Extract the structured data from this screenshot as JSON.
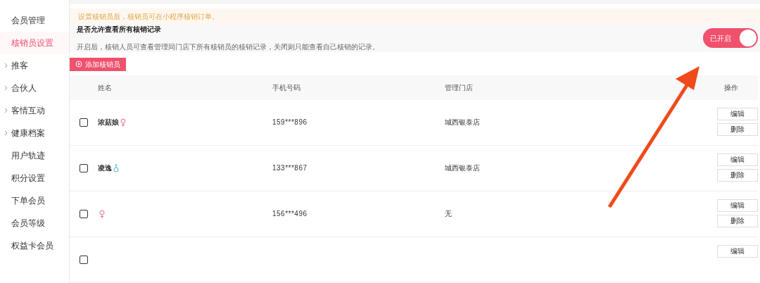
{
  "sidebar": {
    "items": [
      {
        "label": "会员管理",
        "selected": false,
        "expandable": false
      },
      {
        "label": "核销员设置",
        "selected": true,
        "expandable": false
      },
      {
        "label": "推客",
        "selected": false,
        "expandable": true
      },
      {
        "label": "合伙人",
        "selected": false,
        "expandable": true
      },
      {
        "label": "客情互动",
        "selected": false,
        "expandable": true
      },
      {
        "label": "健康档案",
        "selected": false,
        "expandable": true
      },
      {
        "label": "用户轨迹",
        "selected": false,
        "expandable": false
      },
      {
        "label": "积分设置",
        "selected": false,
        "expandable": false
      },
      {
        "label": "下单会员",
        "selected": false,
        "expandable": false
      },
      {
        "label": "会员等级",
        "selected": false,
        "expandable": false
      },
      {
        "label": "权益卡会员",
        "selected": false,
        "expandable": false
      }
    ]
  },
  "notice": "设置核销员后，核销员可在小程序核销订单。",
  "setting": {
    "title": "是否允许查看所有核销记录",
    "description": "开启后，核销人员可查看管理同门店下所有核销员的核销记录，关闭则只能查看自己核销的记录。",
    "toggle": {
      "on": true,
      "label": "已开启"
    }
  },
  "add_button": "添加核销员",
  "table": {
    "columns": [
      "姓名",
      "手机号码",
      "管理门店",
      "操作"
    ],
    "rows": [
      {
        "checked": false,
        "name": "浓菇娘",
        "kind": "female",
        "phone": "159***896",
        "store": "城西银泰店",
        "actions": [
          "编辑",
          "删除"
        ]
      },
      {
        "checked": false,
        "name": "凌逸",
        "kind": "male",
        "phone": "133***867",
        "store": "城西银泰店",
        "actions": [
          "编辑",
          "删除"
        ]
      },
      {
        "checked": false,
        "kind": "female",
        "phone": "156***496",
        "store": "无",
        "actions": [
          "编辑",
          "删除"
        ]
      },
      {
        "checked": false,
        "actions": [
          "编辑"
        ]
      }
    ]
  }
}
